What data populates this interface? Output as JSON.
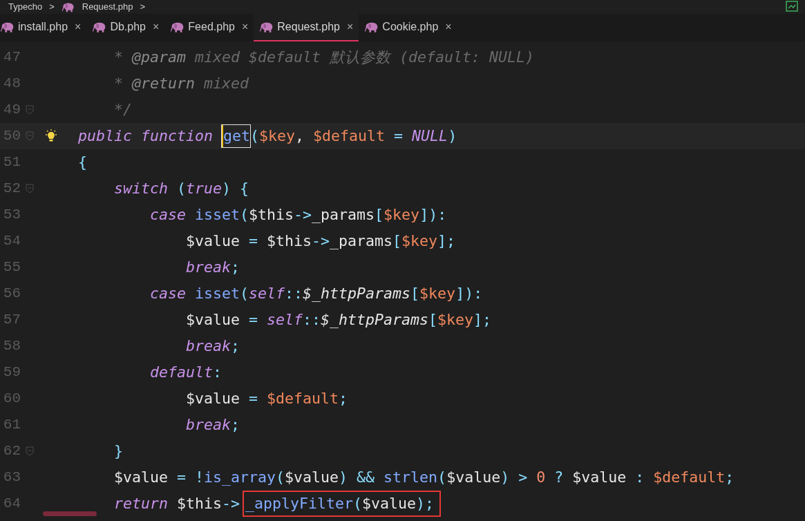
{
  "breadcrumb": [
    "Typecho",
    ">",
    "Request.php",
    ">"
  ],
  "tabs": [
    {
      "label": "install.php",
      "close": "×",
      "selected": false
    },
    {
      "label": "Db.php",
      "close": "×",
      "selected": false
    },
    {
      "label": "Feed.php",
      "close": "×",
      "selected": false
    },
    {
      "label": "Request.php",
      "close": "×",
      "selected": true
    },
    {
      "label": "Cookie.php",
      "close": "×",
      "selected": false
    }
  ],
  "lines": [
    {
      "number": "47",
      "fold": false,
      "bulb": false,
      "current": false,
      "tokens": [
        {
          "t": "    * ",
          "kind": "cm"
        },
        {
          "t": "@param",
          "kind": "tag"
        },
        {
          "t": " mixed $default 默认参数 (default: NULL)",
          "kind": "cm"
        }
      ]
    },
    {
      "number": "48",
      "fold": false,
      "bulb": false,
      "current": false,
      "tokens": [
        {
          "t": "    * ",
          "kind": "cm"
        },
        {
          "t": "@return",
          "kind": "tag"
        },
        {
          "t": " mixed",
          "kind": "cm"
        }
      ]
    },
    {
      "number": "49",
      "fold": true,
      "bulb": false,
      "current": false,
      "tokens": [
        {
          "t": "    */",
          "kind": "cm"
        }
      ]
    },
    {
      "number": "50",
      "fold": true,
      "bulb": true,
      "current": true,
      "tokens": [
        {
          "t": "public function ",
          "kind": "kw"
        },
        {
          "t": "get",
          "kind": "fn",
          "cursor": true
        },
        {
          "t": "(",
          "kind": "pun"
        },
        {
          "t": "$key",
          "kind": "var"
        },
        {
          "t": ", ",
          "kind": "txt"
        },
        {
          "t": "$default",
          "kind": "var"
        },
        {
          "t": " = ",
          "kind": "pun"
        },
        {
          "t": "NULL",
          "kind": "kw"
        },
        {
          "t": ")",
          "kind": "pun"
        }
      ]
    },
    {
      "number": "51",
      "fold": false,
      "bulb": false,
      "current": false,
      "tokens": [
        {
          "t": "{",
          "kind": "pun"
        }
      ]
    },
    {
      "number": "52",
      "fold": true,
      "bulb": false,
      "current": false,
      "tokens": [
        {
          "t": "    switch",
          "kind": "kw"
        },
        {
          "t": " (",
          "kind": "pun"
        },
        {
          "t": "true",
          "kind": "kw"
        },
        {
          "t": ") {",
          "kind": "pun"
        }
      ]
    },
    {
      "number": "53",
      "fold": false,
      "bulb": false,
      "current": false,
      "tokens": [
        {
          "t": "        case ",
          "kind": "kw"
        },
        {
          "t": "isset",
          "kind": "fn"
        },
        {
          "t": "(",
          "kind": "pun"
        },
        {
          "t": "$this",
          "kind": "txt"
        },
        {
          "t": "->",
          "kind": "pun"
        },
        {
          "t": "_params",
          "kind": "txt"
        },
        {
          "t": "[",
          "kind": "pun"
        },
        {
          "t": "$key",
          "kind": "var"
        },
        {
          "t": "]):",
          "kind": "pun"
        }
      ]
    },
    {
      "number": "54",
      "fold": false,
      "bulb": false,
      "current": false,
      "tokens": [
        {
          "t": "            $value",
          "kind": "txt"
        },
        {
          "t": " = ",
          "kind": "pun"
        },
        {
          "t": "$this",
          "kind": "txt"
        },
        {
          "t": "->",
          "kind": "pun"
        },
        {
          "t": "_params",
          "kind": "txt"
        },
        {
          "t": "[",
          "kind": "pun"
        },
        {
          "t": "$key",
          "kind": "var"
        },
        {
          "t": "];",
          "kind": "pun"
        }
      ]
    },
    {
      "number": "55",
      "fold": false,
      "bulb": false,
      "current": false,
      "tokens": [
        {
          "t": "            break",
          "kind": "kw"
        },
        {
          "t": ";",
          "kind": "pun"
        }
      ]
    },
    {
      "number": "56",
      "fold": false,
      "bulb": false,
      "current": false,
      "tokens": [
        {
          "t": "        case ",
          "kind": "kw"
        },
        {
          "t": "isset",
          "kind": "fn"
        },
        {
          "t": "(",
          "kind": "pun"
        },
        {
          "t": "self",
          "kind": "kw"
        },
        {
          "t": "::",
          "kind": "pun"
        },
        {
          "t": "$_httpParams",
          "kind": "st"
        },
        {
          "t": "[",
          "kind": "pun"
        },
        {
          "t": "$key",
          "kind": "var"
        },
        {
          "t": "]):",
          "kind": "pun"
        }
      ]
    },
    {
      "number": "57",
      "fold": false,
      "bulb": false,
      "current": false,
      "tokens": [
        {
          "t": "            $value",
          "kind": "txt"
        },
        {
          "t": " = ",
          "kind": "pun"
        },
        {
          "t": "self",
          "kind": "kw"
        },
        {
          "t": "::",
          "kind": "pun"
        },
        {
          "t": "$_httpParams",
          "kind": "st"
        },
        {
          "t": "[",
          "kind": "pun"
        },
        {
          "t": "$key",
          "kind": "var"
        },
        {
          "t": "];",
          "kind": "pun"
        }
      ]
    },
    {
      "number": "58",
      "fold": false,
      "bulb": false,
      "current": false,
      "tokens": [
        {
          "t": "            break",
          "kind": "kw"
        },
        {
          "t": ";",
          "kind": "pun"
        }
      ]
    },
    {
      "number": "59",
      "fold": false,
      "bulb": false,
      "current": false,
      "tokens": [
        {
          "t": "        default",
          "kind": "kw"
        },
        {
          "t": ":",
          "kind": "pun"
        }
      ]
    },
    {
      "number": "60",
      "fold": false,
      "bulb": false,
      "current": false,
      "tokens": [
        {
          "t": "            $value",
          "kind": "txt"
        },
        {
          "t": " = ",
          "kind": "pun"
        },
        {
          "t": "$default",
          "kind": "var"
        },
        {
          "t": ";",
          "kind": "pun"
        }
      ]
    },
    {
      "number": "61",
      "fold": false,
      "bulb": false,
      "current": false,
      "tokens": [
        {
          "t": "            break",
          "kind": "kw"
        },
        {
          "t": ";",
          "kind": "pun"
        }
      ]
    },
    {
      "number": "62",
      "fold": true,
      "bulb": false,
      "current": false,
      "tokens": [
        {
          "t": "    }",
          "kind": "pun"
        }
      ]
    },
    {
      "number": "63",
      "fold": false,
      "bulb": false,
      "current": false,
      "tokens": [
        {
          "t": "    $value",
          "kind": "txt"
        },
        {
          "t": " = !",
          "kind": "pun"
        },
        {
          "t": "is_array",
          "kind": "fn"
        },
        {
          "t": "(",
          "kind": "pun"
        },
        {
          "t": "$value",
          "kind": "txt"
        },
        {
          "t": ") && ",
          "kind": "pun"
        },
        {
          "t": "strlen",
          "kind": "fn"
        },
        {
          "t": "(",
          "kind": "pun"
        },
        {
          "t": "$value",
          "kind": "txt"
        },
        {
          "t": ") > ",
          "kind": "pun"
        },
        {
          "t": "0",
          "kind": "num"
        },
        {
          "t": " ? ",
          "kind": "pun"
        },
        {
          "t": "$value",
          "kind": "txt"
        },
        {
          "t": " : ",
          "kind": "pun"
        },
        {
          "t": "$default",
          "kind": "var"
        },
        {
          "t": ";",
          "kind": "pun"
        }
      ]
    },
    {
      "number": "64",
      "fold": false,
      "bulb": false,
      "current": false,
      "tokens": [
        {
          "t": "    return ",
          "kind": "kw"
        },
        {
          "t": "$this",
          "kind": "txt"
        },
        {
          "t": "->",
          "kind": "pun"
        },
        {
          "kind": "group",
          "boxed": true,
          "tokens": [
            {
              "t": "_applyFilter",
              "kind": "fn"
            },
            {
              "t": "(",
              "kind": "pun"
            },
            {
              "t": "$value",
              "kind": "txt"
            },
            {
              "t": ");",
              "kind": "pun"
            }
          ]
        }
      ]
    }
  ]
}
